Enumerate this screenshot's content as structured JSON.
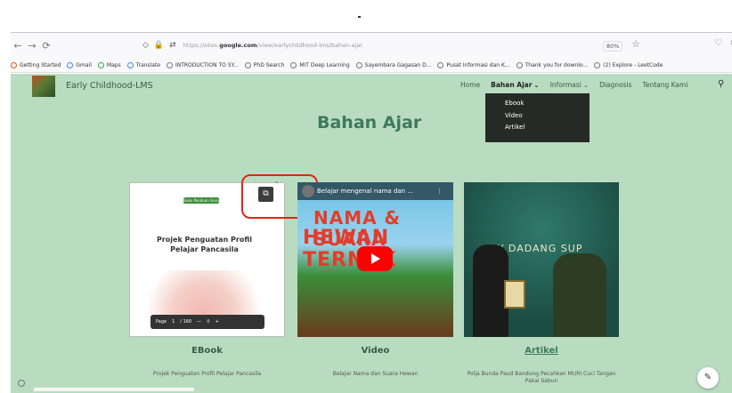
{
  "browser": {
    "url_prefix": "https://sites.",
    "url_host": "google.com",
    "url_path": "/view/earlychildhood-lms/bahan-ajar",
    "zoom": "80%"
  },
  "bookmarks": [
    "Getting Started",
    "Gmail",
    "Maps",
    "Translate",
    "INTRODUCTION TO SY...",
    "PhD Search",
    "MIT Deep Learning",
    "Sayembara Gagasan D...",
    "Pusat Informasi dan K...",
    "Thank you for downlo...",
    "(2) Explore - LeetCode"
  ],
  "site": {
    "title": "Early Childhood-LMS",
    "menu": [
      "Home",
      "Bahan Ajar",
      "Informasi",
      "Diagnosis",
      "Tentang Kami"
    ],
    "dropdown": [
      "Ebook",
      "Video",
      "Artikel"
    ],
    "heading": "Bahan Ajar"
  },
  "cards": {
    "ebook": {
      "label": "EBook",
      "desc": "Projek Penguatan Profil Pelajar Pancasila",
      "pill": "Buku Panduan Guru",
      "book_title": "Projek Penguatan Profil Pelajar Pancasila",
      "page_label": "Page",
      "page_num": "1",
      "page_total": "/ 160"
    },
    "video": {
      "label": "Video",
      "desc": "Belajar Nama dan Suara Hewan",
      "video_title": "Belajar mengenal nama dan ...",
      "line1": "NAMA & SUARA",
      "line2": "HEWAN TERNAK"
    },
    "articles": {
      "label": "Artikel",
      "desc": "Polja Bunda Paud Bandung Pecahkan MURI Cuci Tangan Pakai Sabun",
      "banner": "TY DADANG SUP"
    }
  }
}
